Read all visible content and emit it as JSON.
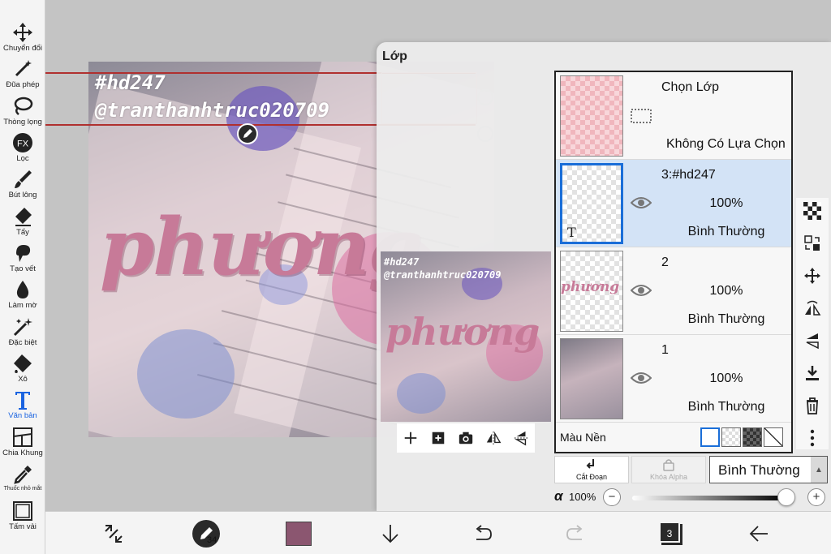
{
  "toolbar": {
    "tools": [
      {
        "label": "Chuyển đổi",
        "icon": "move-icon"
      },
      {
        "label": "Đũa phép",
        "icon": "magic-wand-icon"
      },
      {
        "label": "Thòng lọng",
        "icon": "lasso-icon"
      },
      {
        "label": "Lọc",
        "icon": "fx-filter-icon"
      },
      {
        "label": "Bút lông",
        "icon": "brush-icon"
      },
      {
        "label": "Tẩy",
        "icon": "eraser-icon"
      },
      {
        "label": "Tạo vết",
        "icon": "smudge-icon"
      },
      {
        "label": "Làm mờ",
        "icon": "blur-drop-icon"
      },
      {
        "label": "Đặc biệt",
        "icon": "special-pen-icon"
      },
      {
        "label": "Xô",
        "icon": "bucket-icon"
      },
      {
        "label": "Văn bản",
        "icon": "text-tool-icon"
      },
      {
        "label": "Chia Khung",
        "icon": "frame-divider-icon"
      },
      {
        "label": "Thuốc nhỏ mắt",
        "icon": "eyedropper-icon"
      },
      {
        "label": "Tấm vải",
        "icon": "canvas-icon"
      }
    ],
    "active_tool": "Văn bản",
    "fx_text": "FX"
  },
  "canvas": {
    "watermark_line1": "#hd247",
    "watermark_line2": "@tranthanhtruc020709",
    "script_text": "phương"
  },
  "layer_panel": {
    "title": "Lớp",
    "selection_row": {
      "name": "Chọn Lớp",
      "status": "Không Có Lựa Chọn"
    },
    "layers": [
      {
        "name": "3:#hd247",
        "opacity": "100%",
        "blend": "Bình Thường",
        "selected": true,
        "type_marker": "T"
      },
      {
        "name": "2",
        "opacity": "100%",
        "blend": "Bình Thường",
        "selected": false,
        "thumb_text": "phương"
      },
      {
        "name": "1",
        "opacity": "100%",
        "blend": "Bình Thường",
        "selected": false
      }
    ],
    "background_label": "Màu Nền",
    "cut_label": "Cắt Đoạn",
    "alpha_lock_label": "Khóa Alpha",
    "blend_mode_value": "Bình Thường",
    "alpha_symbol": "α",
    "alpha_value": "100%",
    "minus": "−",
    "plus": "+",
    "opacity_fraction": 1.0
  },
  "preview": {
    "line1": "#hd247",
    "line2": "@tranthanhtruc020709",
    "script": "phương"
  },
  "bottom_bar": {
    "brush_size": "34",
    "current_color": "#8b5670",
    "layers_count": "3"
  },
  "colors": {
    "accent": "#1a63e0",
    "selected_row": "#d3e3f6",
    "selection_line": "#b0302f"
  }
}
